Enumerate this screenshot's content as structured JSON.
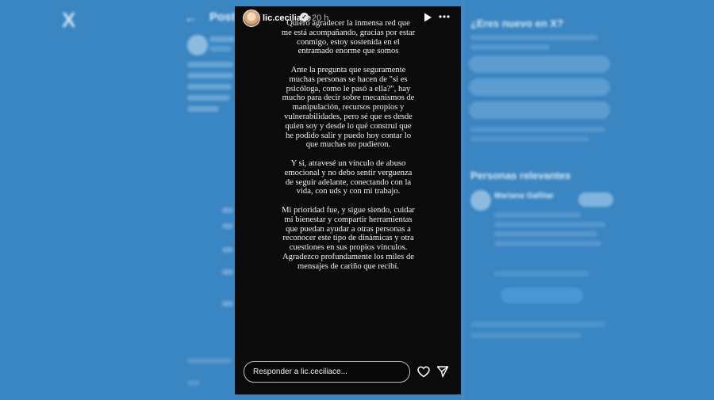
{
  "background_page": {
    "x_logo": "X",
    "back_arrow": "←",
    "title": "Post",
    "sidebar_title": "¿Eres nuevo en X?",
    "relevant_title": "Personas relevantes",
    "relevant_name": "Mariana Gallitar"
  },
  "story": {
    "username": "lic.ceciliace",
    "verified_mark": "✓",
    "time_ago": "20 h",
    "paragraphs": [
      "Quiero agradecer la inmensa red que me está acompañando, gracias por estar conmigo, estoy sostenida en el entramado enorme que somos",
      "Ante la pregunta que seguramente muchas personas se hacen de \"si es psicóloga, como le pasó a ella?\", hay mucho para decir sobre mecanismos de manipulación, recursos propios y vulnerabilidades, pero sé que es desde quien soy y desde lo qué construí que he podido salir y puedo hoy contar lo que muchas no pudieron.",
      "Y si, atravesé un vínculo de abuso emocional y no debo sentir verguenza de seguir adelante, conectando con la vida, con uds y con mi trabajo.",
      "Mi prioridad fue, y sigue siendo, cuidar mi bienestar y compartir herramientas que puedan ayudar a otras personas a reconocer este tipo de dinámicas y otra cuestiones en sus propios vínculos.",
      "Agradezco profundamente los miles de mensajes de cariño que recibí."
    ],
    "reply_placeholder": "Responder a lic.ceciliace...",
    "icons": {
      "play": "play-icon",
      "more": "more-options-icon",
      "heart": "heart-icon",
      "send": "send-icon"
    }
  },
  "colors": {
    "overlay_blue": "#2e78b4",
    "story_bg": "#0b0b0b",
    "text": "#f2f2f2"
  }
}
